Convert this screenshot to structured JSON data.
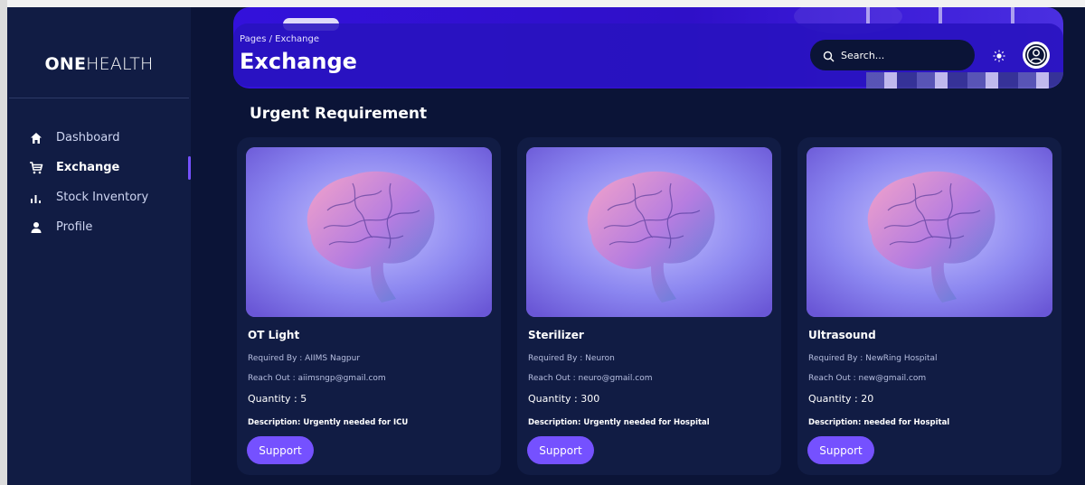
{
  "brand": {
    "bold": "ONE",
    "light": "HEALTH"
  },
  "sidebar": {
    "items": [
      {
        "label": "Dashboard",
        "icon": "home-icon",
        "active": false
      },
      {
        "label": "Exchange",
        "icon": "cart-icon",
        "active": true
      },
      {
        "label": "Stock Inventory",
        "icon": "bar-chart-icon",
        "active": false
      },
      {
        "label": "Profile",
        "icon": "person-icon",
        "active": false
      }
    ]
  },
  "header": {
    "breadcrumb": "Pages / Exchange",
    "title": "Exchange",
    "search_placeholder": "Search..."
  },
  "main": {
    "section_title": "Urgent Requirement",
    "cards": [
      {
        "name": "OT Light",
        "required_by": "Required By : AIIMS Nagpur",
        "reach_out": "Reach Out : aiimsngp@gmail.com",
        "quantity": "Quantity : 5",
        "description": "Description: Urgently needed for ICU",
        "button": "Support"
      },
      {
        "name": "Sterilizer",
        "required_by": "Required By : Neuron",
        "reach_out": "Reach Out : neuro@gmail.com",
        "quantity": "Quantity : 300",
        "description": "Description: Urgently needed for Hospital",
        "button": "Support"
      },
      {
        "name": "Ultrasound",
        "required_by": "Required By : NewRing Hospital",
        "reach_out": "Reach Out : new@gmail.com",
        "quantity": "Quantity : 20",
        "description": "Description: needed for Hospital",
        "button": "Support"
      }
    ]
  },
  "colors": {
    "background": "#0b1437",
    "panel": "#111c44",
    "accent": "#7551ff",
    "banner": "#3311db"
  }
}
